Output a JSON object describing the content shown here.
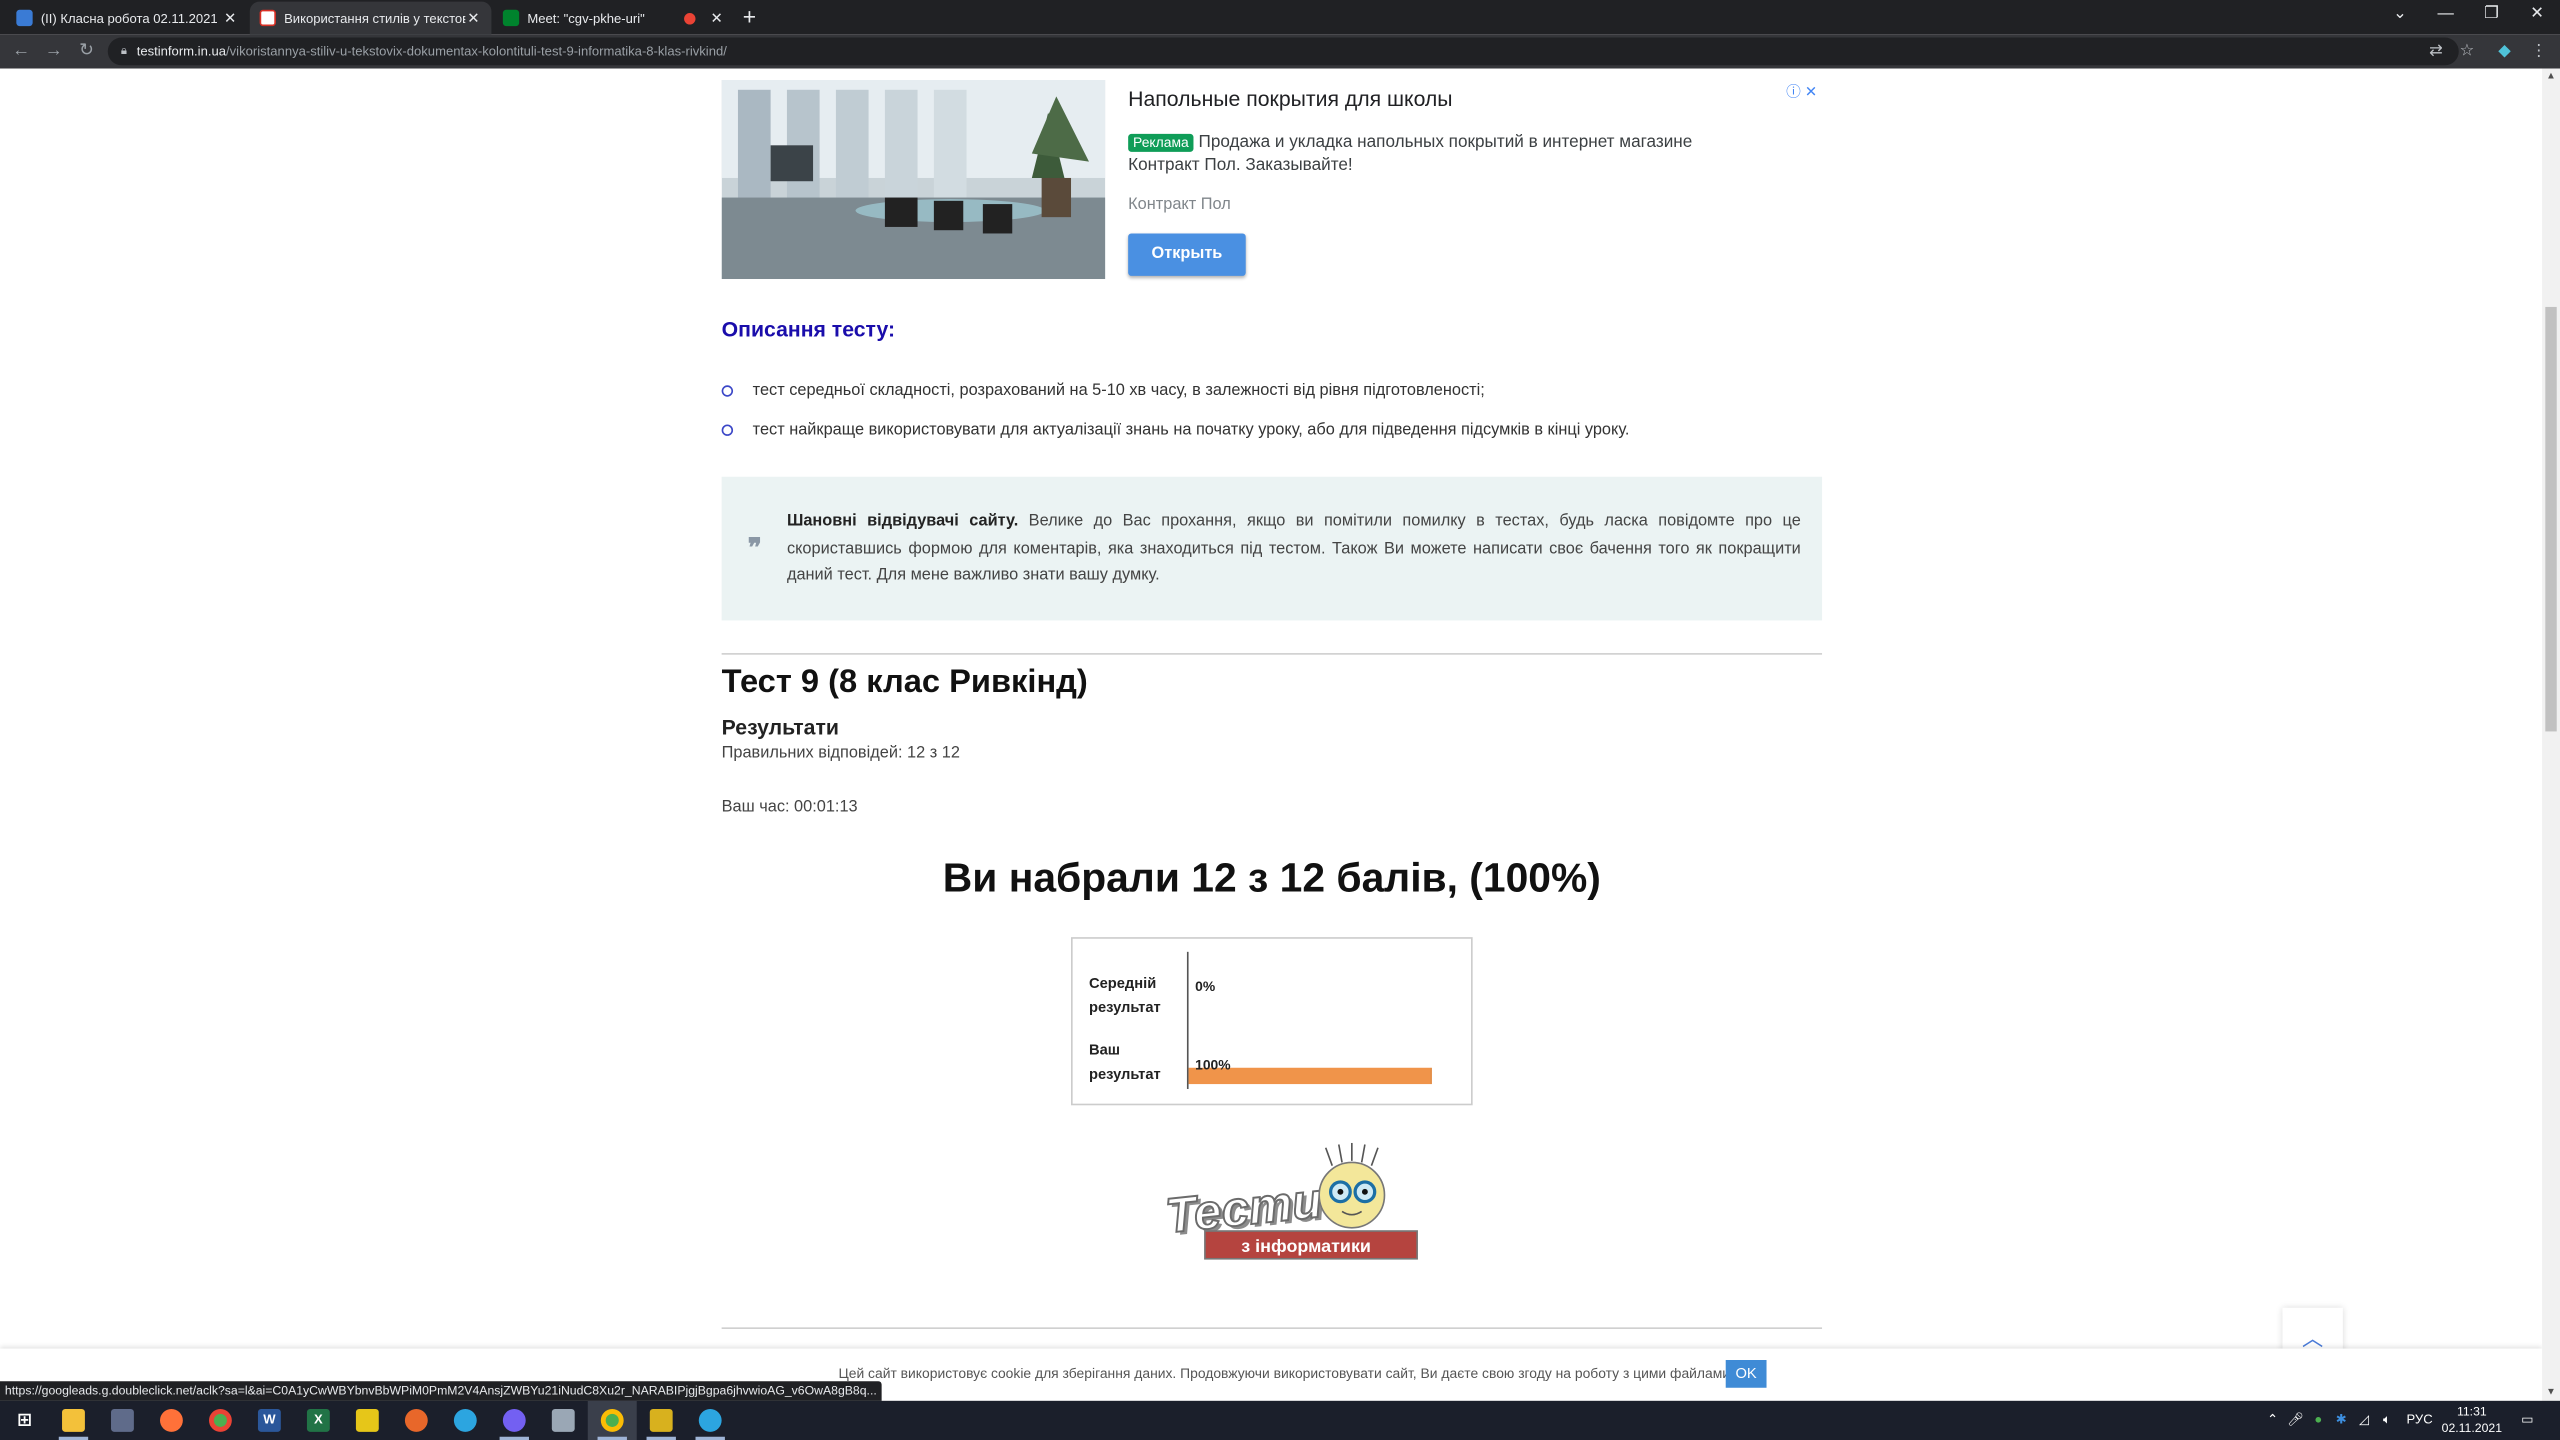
{
  "browser": {
    "tabs": [
      {
        "title": "(II) Класна робота 02.11.2021",
        "favicon_color": "#3a7bd5"
      },
      {
        "title": "Використання стилів у текстових",
        "favicon_color": "#d93025"
      },
      {
        "title": "Meet: \"cgv-pkhe-uri\"",
        "favicon_color": "#00832d"
      }
    ],
    "url_host": "testinform.in.ua",
    "url_path": "/vikoristannya-stiliv-u-tekstovix-dokumentax-kolontituli-test-9-informatika-8-klas-rivkind/",
    "status_url": "https://googleads.g.doubleclick.net/aclk?sa=l&ai=C0A1yCwWBYbnvBbWPiM0PmM2V4AnsjZWBYu21iNudC8Xu2r_NARABIPjgjBgpa6jhvwioAG_v6OwA8gB8q..."
  },
  "ad": {
    "title": "Напольные покрытия для школы",
    "badge": "Реклама",
    "text": "Продажа и укладка напольных покрытий в интернет магазине Контракт Пол. Заказывайте!",
    "company": "Контракт Пол",
    "button": "Открыть",
    "adchoices": "ⓘ ✕"
  },
  "description": {
    "heading": "Описання тесту:",
    "items": [
      "тест середньої складності, розрахований на 5-10 хв часу, в залежності від рівня підготовленості;",
      "тест найкраще використовувати для актуалізації знань на початку уроку, або для підведення підсумків в кінці уроку."
    ]
  },
  "notice": {
    "bold": "Шановні відвідувачі сайту.",
    "text": " Велике до Вас прохання, якщо ви помітили помилку в тестах, будь ласка повідомте про це скориставшись формою для коментарів, яка знаходиться під тестом. Також Ви можете написати своє бачення того як покращити даний тест. Для мене важливо знати вашу думку."
  },
  "test": {
    "title": "Тест 9 (8 клас Ривкінд)",
    "results_label": "Результати",
    "correct": "Правильних відповідей: 12 з 12",
    "time": "Ваш час: 00:01:13",
    "score": "Ви набрали 12 з 12 балів, (100%)"
  },
  "chart_data": {
    "type": "bar",
    "orientation": "horizontal",
    "categories": [
      "Середній результат",
      "Ваш результат"
    ],
    "values": [
      0,
      100
    ],
    "data_labels": [
      "0%",
      "100%"
    ],
    "xlim": [
      0,
      100
    ],
    "color": "#f0944a"
  },
  "logo": {
    "word": "Тести",
    "subtitle": "з інформатики"
  },
  "cookie": {
    "text": "Цей сайт використовує cookie для зберігання даних. Продовжуючи використовувати сайт, Ви даєте свою згоду на роботу з цими файлами.",
    "ok": "OK"
  },
  "taskbar": {
    "lang": "РУС",
    "time": "11:31",
    "date": "02.11.2021"
  }
}
